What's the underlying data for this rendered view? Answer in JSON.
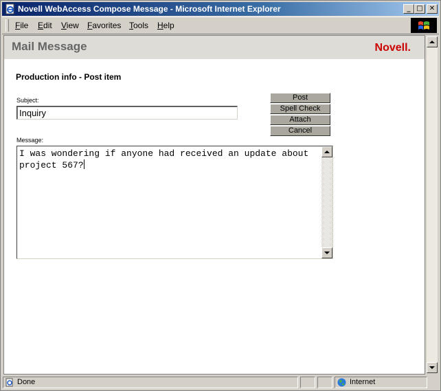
{
  "window": {
    "title": "Novell WebAccess Compose Message - Microsoft Internet Explorer",
    "controls": {
      "minimize": "_",
      "maximize": "□",
      "close": "✕"
    }
  },
  "menubar": {
    "items": [
      "File",
      "Edit",
      "View",
      "Favorites",
      "Tools",
      "Help"
    ]
  },
  "header": {
    "title": "Mail Message",
    "logo": "Novell."
  },
  "form": {
    "heading": "Production info - Post item",
    "subject_label": "Subject:",
    "subject_value": "Inquiry",
    "message_label": "Message:",
    "message_value": "I was wondering if anyone had received an update about\nproject 567?"
  },
  "actions": {
    "post": "Post",
    "spell_check": "Spell Check",
    "attach": "Attach",
    "cancel": "Cancel"
  },
  "statusbar": {
    "status_text": "Done",
    "zone_text": "Internet"
  },
  "colors": {
    "titlebar_start": "#0a246a",
    "titlebar_end": "#a6caf0",
    "logo_red": "#cc0000",
    "button_face": "#aaa79e"
  },
  "icons": [
    "ie-page-icon",
    "windows-logo-icon",
    "globe-icon",
    "document-status-icon"
  ]
}
